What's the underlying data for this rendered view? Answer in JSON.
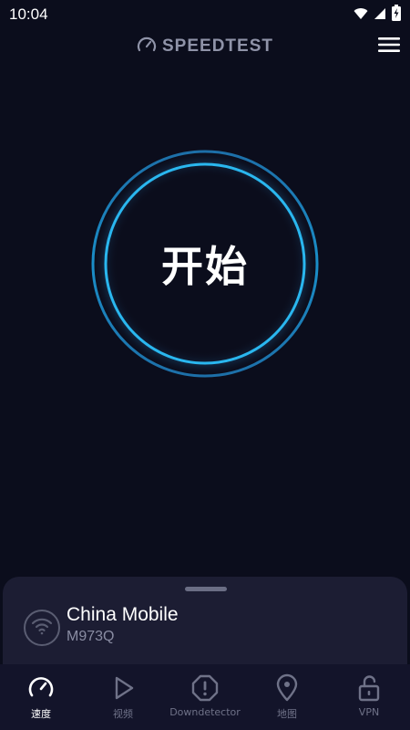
{
  "status_bar": {
    "time": "10:04",
    "icons": [
      "wifi-icon",
      "cellular-signal-icon",
      "battery-charging-icon"
    ]
  },
  "header": {
    "brand": "SPEEDTEST",
    "brand_icon": "speedometer-icon",
    "menu_icon": "hamburger-menu-icon"
  },
  "start_button": {
    "label": "开始",
    "ring_color": "#2ab7ef"
  },
  "connection": {
    "provider": "China Mobile",
    "device": "M973Q",
    "icon": "wifi-icon"
  },
  "tabs": [
    {
      "label": "速度",
      "icon": "speedometer-icon",
      "active": true
    },
    {
      "label": "视频",
      "icon": "play-icon",
      "active": false
    },
    {
      "label": "Downdetector",
      "icon": "alert-icon",
      "active": false
    },
    {
      "label": "地图",
      "icon": "map-pin-icon",
      "active": false
    },
    {
      "label": "VPN",
      "icon": "unlock-icon",
      "active": false
    }
  ],
  "colors": {
    "background": "#0b0d1c",
    "sheet": "#1c1d33",
    "accent": "#2ab7ef",
    "muted": "#6f7288"
  }
}
